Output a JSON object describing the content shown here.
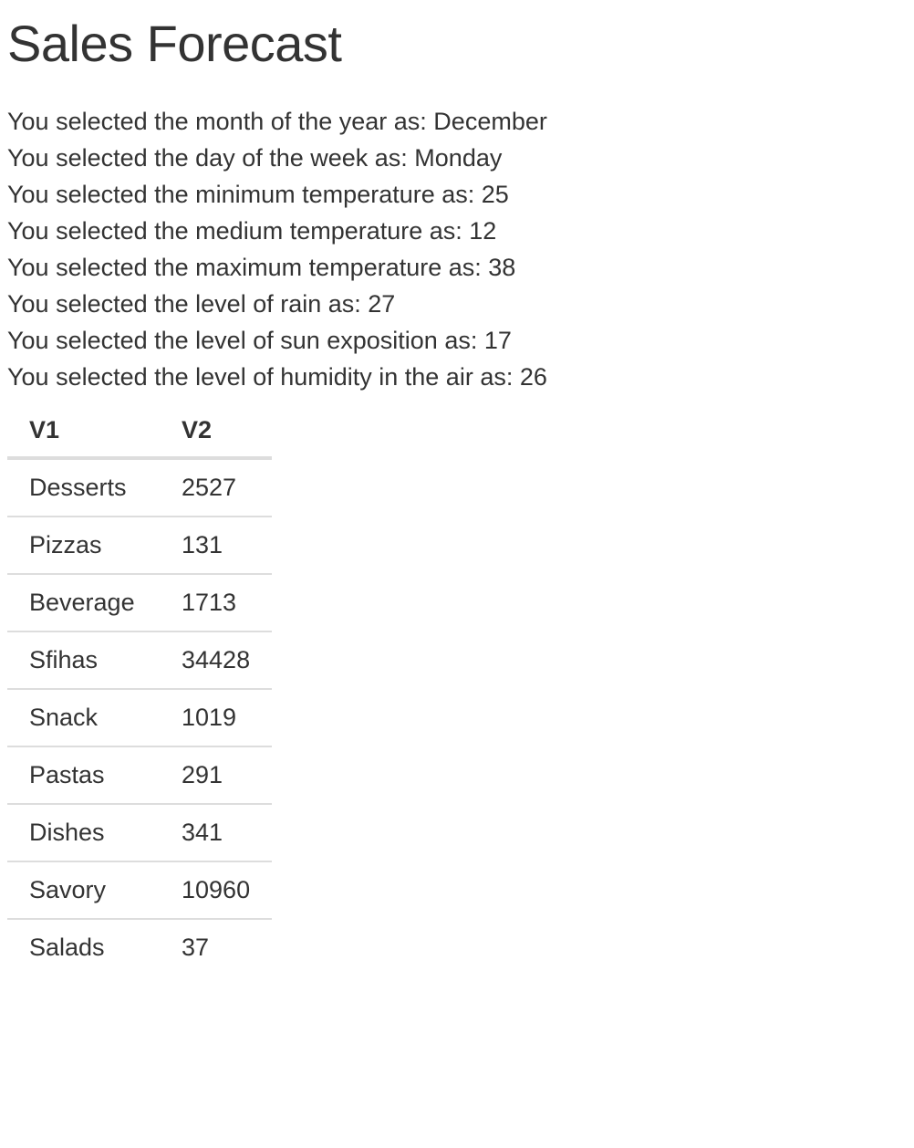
{
  "page": {
    "title": "Sales Forecast"
  },
  "selections": [
    "You selected the month of the year as: December",
    "You selected the day of the week as: Monday",
    "You selected the minimum temperature as: 25",
    "You selected the medium temperature as: 12",
    "You selected the maximum temperature as: 38",
    "You selected the level of rain as: 27",
    "You selected the level of sun exposition as: 17",
    "You selected the level of humidity in the air as: 26"
  ],
  "table": {
    "headers": [
      "V1",
      "V2"
    ],
    "rows": [
      [
        "Desserts",
        "2527"
      ],
      [
        "Pizzas",
        "131"
      ],
      [
        "Beverage",
        "1713"
      ],
      [
        "Sfihas",
        "34428"
      ],
      [
        "Snack",
        "1019"
      ],
      [
        "Pastas",
        "291"
      ],
      [
        "Dishes",
        "341"
      ],
      [
        "Savory",
        "10960"
      ],
      [
        "Salads",
        "37"
      ]
    ]
  },
  "colors": {
    "text": "#333333",
    "table_border": "#dddddd",
    "background": "#ffffff"
  }
}
